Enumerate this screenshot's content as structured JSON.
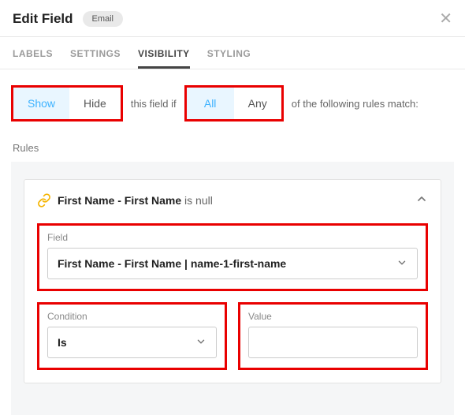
{
  "header": {
    "title": "Edit Field",
    "badge": "Email"
  },
  "tabs": {
    "labels": "LABELS",
    "settings": "SETTINGS",
    "visibility": "VISIBILITY",
    "styling": "STYLING"
  },
  "sentence": {
    "show": "Show",
    "hide": "Hide",
    "mid": "this field if",
    "all": "All",
    "any": "Any",
    "tail": "of the following rules match:"
  },
  "rules_label": "Rules",
  "rule": {
    "summary_bold": "First Name - First Name",
    "summary_tail": " is null",
    "field": {
      "label": "Field",
      "value": "First Name - First Name | name-1-first-name"
    },
    "condition": {
      "label": "Condition",
      "value": "Is"
    },
    "value": {
      "label": "Value",
      "value": ""
    }
  }
}
